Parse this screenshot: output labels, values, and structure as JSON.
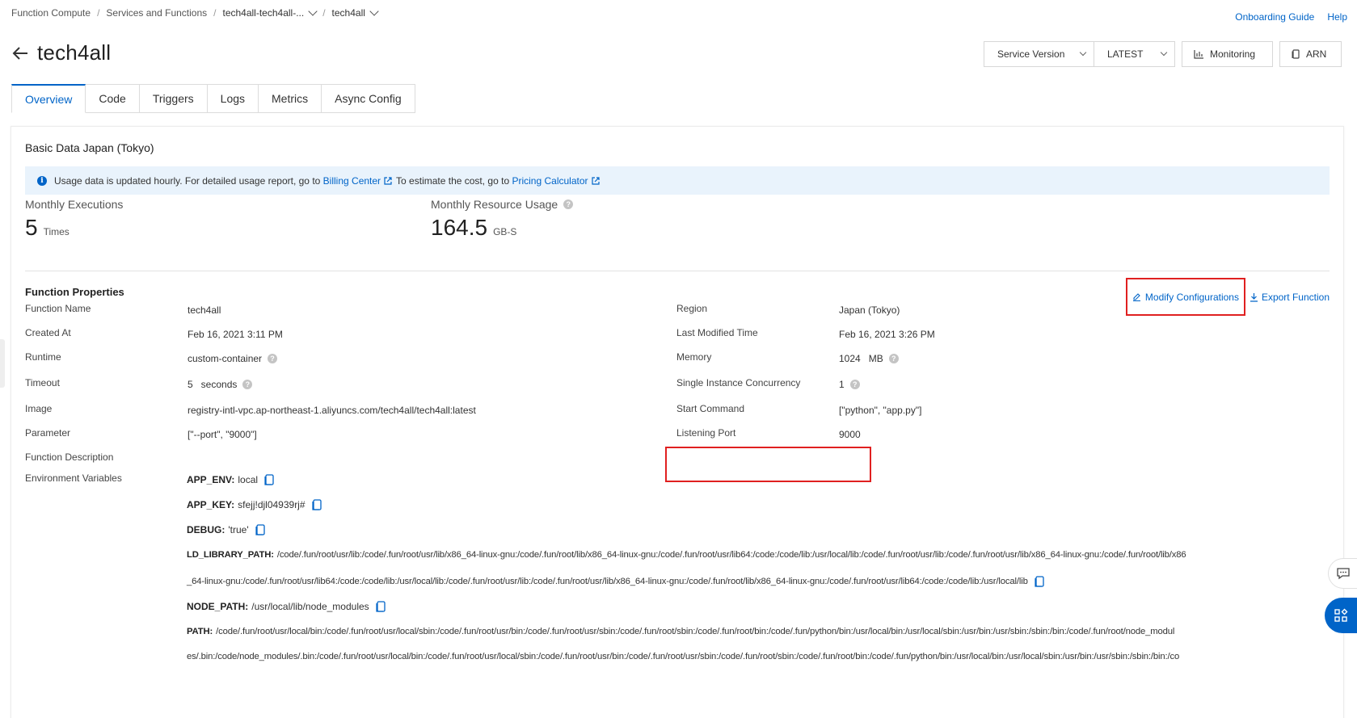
{
  "breadcrumb": {
    "items": [
      "Function Compute",
      "Services and Functions",
      "tech4all-tech4all-...",
      "tech4all"
    ],
    "separator": "/"
  },
  "topright": {
    "guide": "Onboarding Guide",
    "help": "Help"
  },
  "header": {
    "title": "tech4all",
    "service_version_label": "Service Version",
    "version_value": "LATEST",
    "monitoring_label": "Monitoring",
    "arn_label": "ARN"
  },
  "tabs": [
    "Overview",
    "Code",
    "Triggers",
    "Logs",
    "Metrics",
    "Async Config"
  ],
  "basic": {
    "title": "Basic Data Japan (Tokyo)",
    "notice_text": "Usage data is updated hourly. For detailed usage report, go to",
    "billing_link": "Billing Center",
    "notice_mid": "To estimate the cost, go to",
    "pricing_link": "Pricing Calculator",
    "exec_label": "Monthly Executions",
    "exec_value": "5",
    "exec_unit": "Times",
    "res_label": "Monthly Resource Usage",
    "res_value": "164.5",
    "res_unit": "GB-S"
  },
  "props": {
    "title": "Function Properties",
    "modify": "Modify Configurations",
    "export": "Export Function",
    "left": [
      {
        "label": "Function Name",
        "value": "tech4all"
      },
      {
        "label": "Created At",
        "value": "Feb 16, 2021 3:11 PM"
      },
      {
        "label": "Runtime",
        "value": "custom-container"
      },
      {
        "label": "Timeout",
        "value": "5   seconds"
      },
      {
        "label": "Image",
        "value": "registry-intl-vpc.ap-northeast-1.aliyuncs.com/tech4all/tech4all:latest"
      },
      {
        "label": "Parameter",
        "value": "[\"--port\", \"9000\"]"
      },
      {
        "label": "Function Description",
        "value": ""
      },
      {
        "label": "Environment Variables",
        "value": ""
      }
    ],
    "right": [
      {
        "label": "Region",
        "value": "Japan (Tokyo)"
      },
      {
        "label": "Last Modified Time",
        "value": "Feb 16, 2021 3:26 PM"
      },
      {
        "label": "Memory",
        "value": "1024   MB"
      },
      {
        "label": "Single Instance Concurrency",
        "value": "1"
      },
      {
        "label": "Start Command",
        "value": "[\"python\", \"app.py\"]"
      },
      {
        "label": "Listening Port",
        "value": "9000"
      }
    ]
  },
  "env": [
    {
      "key": "APP_ENV:",
      "value": "local"
    },
    {
      "key": "APP_KEY:",
      "value": "sfejj!djl04939rj#"
    },
    {
      "key": "DEBUG:",
      "value": "'true'"
    },
    {
      "key": "LD_LIBRARY_PATH:",
      "value": "/code/.fun/root/usr/lib:/code/.fun/root/usr/lib/x86_64-linux-gnu:/code/.fun/root/lib/x86_64-linux-gnu:/code/.fun/root/usr/lib64:/code:/code/lib:/usr/local/lib:/code/.fun/root/usr/lib:/code/.fun/root/usr/lib/x86_64-linux-gnu:/code/.fun/root/lib/x86"
    },
    {
      "key": "",
      "value": "_64-linux-gnu:/code/.fun/root/usr/lib64:/code:/code/lib:/usr/local/lib:/code/.fun/root/usr/lib:/code/.fun/root/usr/lib/x86_64-linux-gnu:/code/.fun/root/lib/x86_64-linux-gnu:/code/.fun/root/usr/lib64:/code:/code/lib:/usr/local/lib"
    },
    {
      "key": "NODE_PATH:",
      "value": "/usr/local/lib/node_modules"
    },
    {
      "key": "PATH:",
      "value": "/code/.fun/root/usr/local/bin:/code/.fun/root/usr/local/sbin:/code/.fun/root/usr/bin:/code/.fun/root/usr/sbin:/code/.fun/root/sbin:/code/.fun/root/bin:/code/.fun/python/bin:/usr/local/bin:/usr/local/sbin:/usr/bin:/usr/sbin:/sbin:/bin:/code/.fun/root/node_modul"
    },
    {
      "key": "",
      "value": "es/.bin:/code/node_modules/.bin:/code/.fun/root/usr/local/bin:/code/.fun/root/usr/local/sbin:/code/.fun/root/usr/bin:/code/.fun/root/usr/sbin:/code/.fun/root/sbin:/code/.fun/root/bin:/code/.fun/python/bin:/usr/local/bin:/usr/local/sbin:/usr/bin:/usr/sbin:/sbin:/bin:/co"
    }
  ]
}
